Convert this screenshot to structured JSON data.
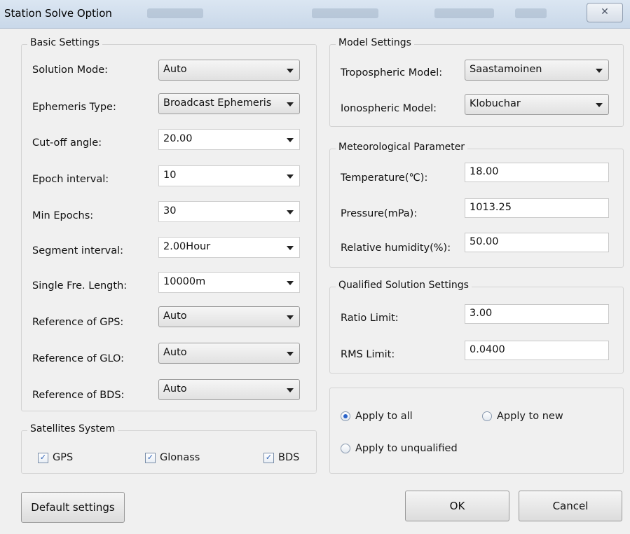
{
  "window": {
    "title": "Station Solve Option",
    "close_glyph": "✕"
  },
  "basic": {
    "legend": "Basic Settings",
    "rows": [
      {
        "label": "Solution Mode:",
        "value": "Auto"
      },
      {
        "label": "Ephemeris Type:",
        "value": "Broadcast Ephemeris"
      },
      {
        "label": "Cut-off angle:",
        "value": "20.00"
      },
      {
        "label": "Epoch interval:",
        "value": "10"
      },
      {
        "label": "Min Epochs:",
        "value": "30"
      },
      {
        "label": "Segment interval:",
        "value": "2.00Hour"
      },
      {
        "label": "Single Fre. Length:",
        "value": "10000m"
      },
      {
        "label": "Reference of GPS:",
        "value": "Auto"
      },
      {
        "label": "Reference of GLO:",
        "value": "Auto"
      },
      {
        "label": "Reference of BDS:",
        "value": "Auto"
      }
    ]
  },
  "satellites": {
    "legend": "Satellites System",
    "items": [
      {
        "label": "GPS",
        "checked": true
      },
      {
        "label": "Glonass",
        "checked": true
      },
      {
        "label": "BDS",
        "checked": true
      }
    ],
    "check_glyph": "✓"
  },
  "model": {
    "legend": "Model Settings",
    "tropo_label": "Tropospheric Model:",
    "tropo_value": "Saastamoinen",
    "iono_label": "Ionospheric Model:",
    "iono_value": "Klobuchar"
  },
  "meteo": {
    "legend": "Meteorological Parameter",
    "temp_label": "Temperature(℃):",
    "temp_value": "18.00",
    "pressure_label": "Pressure(mPa):",
    "pressure_value": "1013.25",
    "humidity_label": "Relative humidity(%):",
    "humidity_value": "50.00"
  },
  "qualified": {
    "legend": "Qualified Solution Settings",
    "ratio_label": "Ratio Limit:",
    "ratio_value": "3.00",
    "rms_label": "RMS Limit:",
    "rms_value": "0.0400"
  },
  "apply": {
    "all": "Apply to all",
    "new": "Apply to new",
    "unqualified": "Apply to unqualified",
    "selected": "all"
  },
  "buttons": {
    "default": "Default settings",
    "ok": "OK",
    "cancel": "Cancel"
  },
  "colors": {
    "accent": "#2a63c9",
    "titlebar": "#c9d8e9",
    "background": "#f0f0f0"
  }
}
